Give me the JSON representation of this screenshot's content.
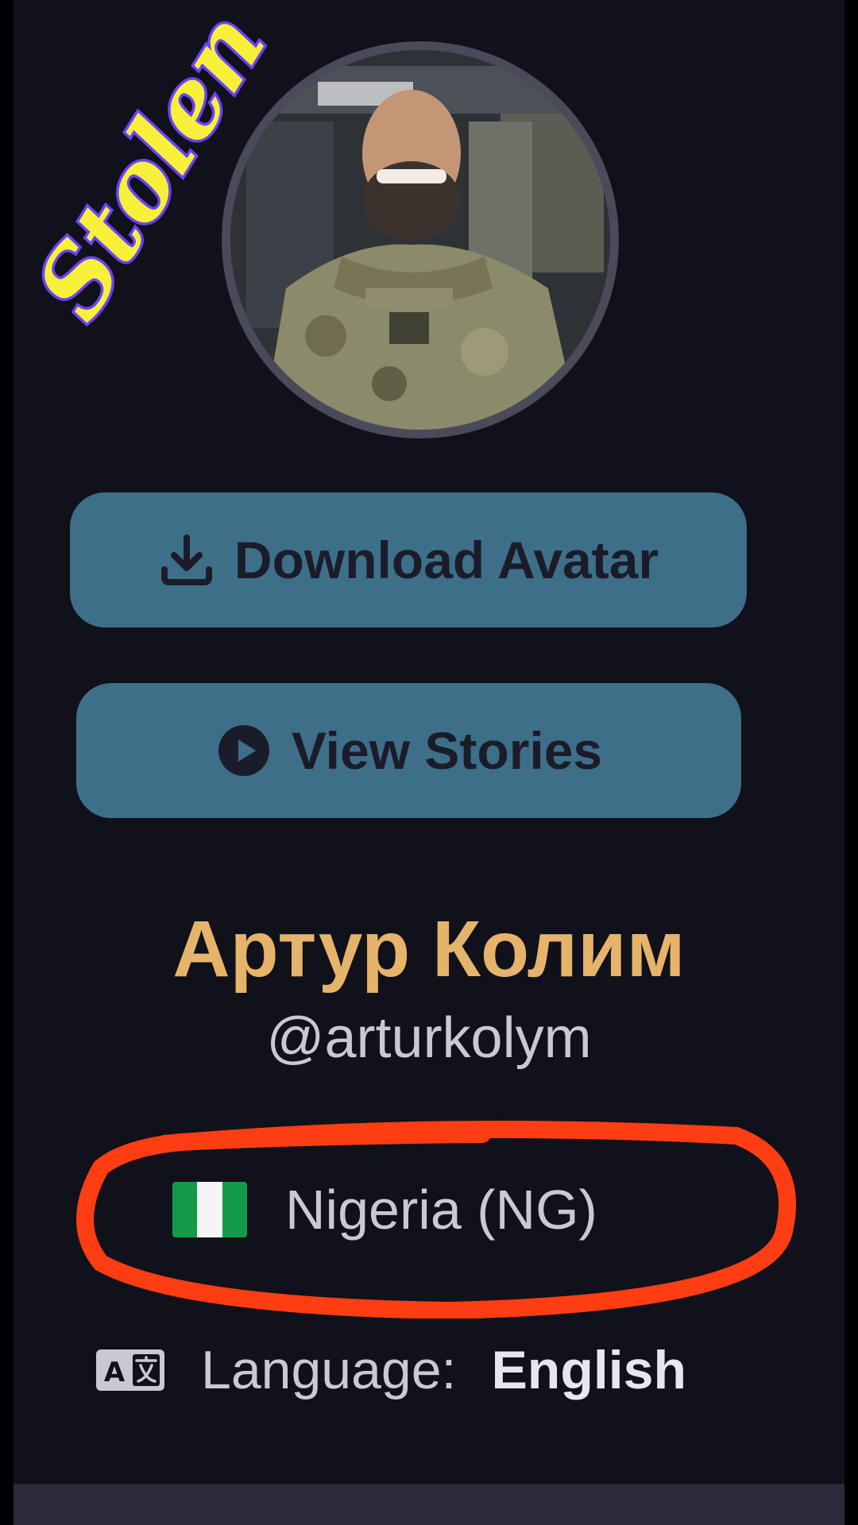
{
  "watermark": {
    "text": "Stolen"
  },
  "profile": {
    "avatar_alt": "profile-photo",
    "display_name": "Артур Колим",
    "username": "@arturkolym"
  },
  "actions": {
    "download_label": "Download Avatar",
    "stories_label": "View Stories"
  },
  "location": {
    "flag": "nigeria-flag",
    "country": "Nigeria (NG)"
  },
  "language": {
    "label": "Language:",
    "value": "English"
  },
  "colors": {
    "background": "#11111b",
    "button": "#3e6f89",
    "name": "#e6b36b",
    "annotation": "#ff3d12"
  }
}
